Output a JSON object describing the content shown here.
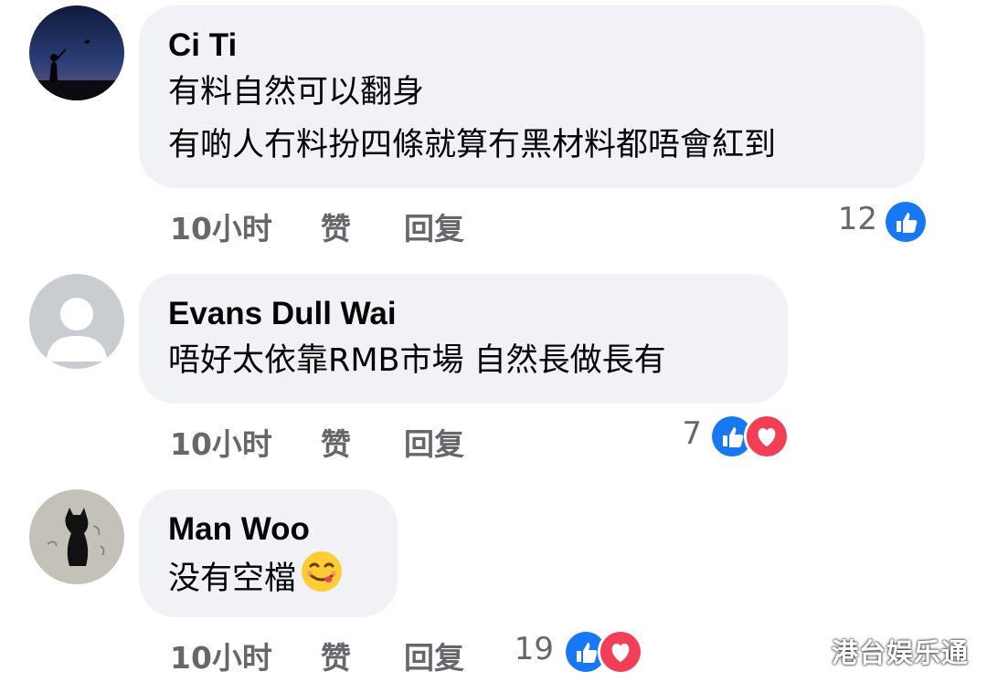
{
  "comments": [
    {
      "author": "Ci Ti",
      "lines": [
        "有料自然可以翻身",
        "有啲人冇料扮四條就算冇黑材料都唔會紅到"
      ],
      "time": "10小时",
      "like_label": "赞",
      "reply_label": "回复",
      "reaction_count": "12",
      "reactions": [
        "like-icon"
      ]
    },
    {
      "author": "Evans Dull Wai",
      "lines": [
        "唔好太依靠RMB市場 自然長做長有"
      ],
      "time": "10小时",
      "like_label": "赞",
      "reply_label": "回复",
      "reaction_count": "7",
      "reactions": [
        "like-icon",
        "love-icon"
      ]
    },
    {
      "author": "Man Woo",
      "lines": [
        "没有空檔"
      ],
      "emoji": "savoring-face-emoji",
      "time": "10小时",
      "like_label": "赞",
      "reply_label": "回复",
      "reaction_count": "19",
      "reactions": [
        "like-icon",
        "love-icon"
      ]
    }
  ],
  "watermark": "港台娱乐通",
  "colors": {
    "bubble": "#f0f2f5",
    "meta_text": "#65676b",
    "like_blue": "#1877f2",
    "love_red": "#f33e58"
  }
}
